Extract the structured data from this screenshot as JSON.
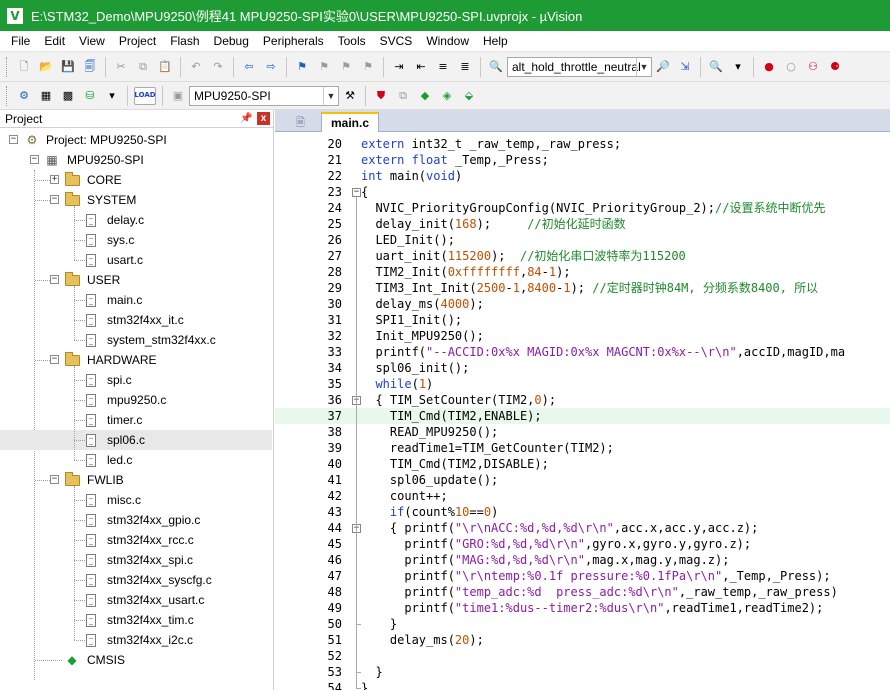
{
  "window": {
    "title": "E:\\STM32_Demo\\MPU9250\\例程41 MPU9250-SPI实验0\\USER\\MPU9250-SPI.uvprojx - µVision",
    "logo": "V"
  },
  "menu": [
    "File",
    "Edit",
    "View",
    "Project",
    "Flash",
    "Debug",
    "Peripherals",
    "Tools",
    "SVCS",
    "Window",
    "Help"
  ],
  "toolbar1": {
    "find_combo": "alt_hold_throttle_neutral"
  },
  "toolbar2": {
    "load_label": "LOAD",
    "target_combo": "MPU9250-SPI"
  },
  "project_panel": {
    "title": "Project",
    "pin": "ꟷ",
    "close": "x",
    "root": "Project: MPU9250-SPI",
    "target": "MPU9250-SPI",
    "groups": [
      {
        "name": "CORE",
        "expanded": false,
        "files": []
      },
      {
        "name": "SYSTEM",
        "expanded": true,
        "files": [
          "delay.c",
          "sys.c",
          "usart.c"
        ]
      },
      {
        "name": "USER",
        "expanded": true,
        "files": [
          "main.c",
          "stm32f4xx_it.c",
          "system_stm32f4xx.c"
        ]
      },
      {
        "name": "HARDWARE",
        "expanded": true,
        "files": [
          "spi.c",
          "mpu9250.c",
          "timer.c",
          "spl06.c",
          "led.c"
        ]
      },
      {
        "name": "FWLIB",
        "expanded": true,
        "files": [
          "misc.c",
          "stm32f4xx_gpio.c",
          "stm32f4xx_rcc.c",
          "stm32f4xx_spi.c",
          "stm32f4xx_syscfg.c",
          "stm32f4xx_usart.c",
          "stm32f4xx_tim.c",
          "stm32f4xx_i2c.c"
        ]
      }
    ],
    "cmsis": "CMSIS",
    "selected_file": "spl06.c"
  },
  "editor": {
    "tab": "main.c",
    "current_line": 37,
    "lines": [
      {
        "n": "20",
        "tokens": [
          [
            "kw",
            "extern"
          ],
          [
            "p",
            " int32_t _raw_temp,_raw_press;"
          ]
        ]
      },
      {
        "n": "21",
        "tokens": [
          [
            "kw",
            "extern"
          ],
          [
            "p",
            " "
          ],
          [
            "kw",
            "float"
          ],
          [
            "p",
            " _Temp,_Press;"
          ]
        ]
      },
      {
        "n": "22",
        "tokens": [
          [
            "kw",
            "int"
          ],
          [
            "p",
            " main("
          ],
          [
            "kw",
            "void"
          ],
          [
            "p",
            ")"
          ]
        ]
      },
      {
        "n": "23",
        "tokens": [
          [
            "p",
            "{"
          ]
        ]
      },
      {
        "n": "24",
        "tokens": [
          [
            "p",
            "  NVIC_PriorityGroupConfig(NVIC_PriorityGroup_2);"
          ],
          [
            "cmt",
            "//设置系统中断优先"
          ]
        ]
      },
      {
        "n": "25",
        "tokens": [
          [
            "p",
            "  delay_init("
          ],
          [
            "num",
            "168"
          ],
          [
            "p",
            ");     "
          ],
          [
            "cmt",
            "//初始化延时函数"
          ]
        ]
      },
      {
        "n": "26",
        "tokens": [
          [
            "p",
            "  LED_Init();"
          ]
        ]
      },
      {
        "n": "27",
        "tokens": [
          [
            "p",
            "  uart_init("
          ],
          [
            "num",
            "115200"
          ],
          [
            "p",
            ");  "
          ],
          [
            "cmt",
            "//初始化串口波特率为115200"
          ]
        ]
      },
      {
        "n": "28",
        "tokens": [
          [
            "p",
            "  TIM2_Init("
          ],
          [
            "num",
            "0xffffffff"
          ],
          [
            "p",
            ","
          ],
          [
            "num",
            "84"
          ],
          [
            "p",
            "-"
          ],
          [
            "num",
            "1"
          ],
          [
            "p",
            ");"
          ]
        ]
      },
      {
        "n": "29",
        "tokens": [
          [
            "p",
            "  TIM3_Int_Init("
          ],
          [
            "num",
            "2500"
          ],
          [
            "p",
            "-"
          ],
          [
            "num",
            "1"
          ],
          [
            "p",
            ","
          ],
          [
            "num",
            "8400"
          ],
          [
            "p",
            "-"
          ],
          [
            "num",
            "1"
          ],
          [
            "p",
            "); "
          ],
          [
            "cmt",
            "//定时器时钟84M, 分频系数8400, 所以"
          ]
        ]
      },
      {
        "n": "30",
        "tokens": [
          [
            "p",
            "  delay_ms("
          ],
          [
            "num",
            "4000"
          ],
          [
            "p",
            ");"
          ]
        ]
      },
      {
        "n": "31",
        "tokens": [
          [
            "p",
            "  SPI1_Init();"
          ]
        ]
      },
      {
        "n": "32",
        "tokens": [
          [
            "p",
            "  Init_MPU9250();"
          ]
        ]
      },
      {
        "n": "33",
        "tokens": [
          [
            "p",
            "  printf("
          ],
          [
            "str",
            "\"--ACCID:0x%x MAGID:0x%x MAGCNT:0x%x--\\r\\n\""
          ],
          [
            "p",
            ",accID,magID,ma"
          ]
        ]
      },
      {
        "n": "34",
        "tokens": [
          [
            "p",
            "  spl06_init();"
          ]
        ]
      },
      {
        "n": "35",
        "tokens": [
          [
            "p",
            "  "
          ],
          [
            "kw",
            "while"
          ],
          [
            "p",
            "("
          ],
          [
            "num",
            "1"
          ],
          [
            "p",
            ")"
          ]
        ]
      },
      {
        "n": "36",
        "tokens": [
          [
            "p",
            "  { TIM_SetCounter(TIM2,"
          ],
          [
            "num",
            "0"
          ],
          [
            "p",
            ");"
          ]
        ]
      },
      {
        "n": "37",
        "tokens": [
          [
            "p",
            "    TIM_Cmd(TIM2,ENABLE);"
          ]
        ]
      },
      {
        "n": "38",
        "tokens": [
          [
            "p",
            "    READ_MPU9250();"
          ]
        ]
      },
      {
        "n": "39",
        "tokens": [
          [
            "p",
            "    readTime1=TIM_GetCounter(TIM2);"
          ]
        ]
      },
      {
        "n": "40",
        "tokens": [
          [
            "p",
            "    TIM_Cmd(TIM2,DISABLE);"
          ]
        ]
      },
      {
        "n": "41",
        "tokens": [
          [
            "p",
            "    spl06_update();"
          ]
        ]
      },
      {
        "n": "42",
        "tokens": [
          [
            "p",
            "    count++;"
          ]
        ]
      },
      {
        "n": "43",
        "tokens": [
          [
            "p",
            "    "
          ],
          [
            "kw",
            "if"
          ],
          [
            "p",
            "(count%"
          ],
          [
            "num",
            "10"
          ],
          [
            "p",
            "=="
          ],
          [
            "num",
            "0"
          ],
          [
            "p",
            ")"
          ]
        ]
      },
      {
        "n": "44",
        "tokens": [
          [
            "p",
            "    { printf("
          ],
          [
            "str",
            "\"\\r\\nACC:%d,%d,%d\\r\\n\""
          ],
          [
            "p",
            ",acc.x,acc.y,acc.z);"
          ]
        ]
      },
      {
        "n": "45",
        "tokens": [
          [
            "p",
            "      printf("
          ],
          [
            "str",
            "\"GRO:%d,%d,%d\\r\\n\""
          ],
          [
            "p",
            ",gyro.x,gyro.y,gyro.z);"
          ]
        ]
      },
      {
        "n": "46",
        "tokens": [
          [
            "p",
            "      printf("
          ],
          [
            "str",
            "\"MAG:%d,%d,%d\\r\\n\""
          ],
          [
            "p",
            ",mag.x,mag.y,mag.z);"
          ]
        ]
      },
      {
        "n": "47",
        "tokens": [
          [
            "p",
            "      printf("
          ],
          [
            "str",
            "\"\\r\\ntemp:%0.1f pressure:%0.1fPa\\r\\n\""
          ],
          [
            "p",
            ",_Temp,_Press);"
          ]
        ]
      },
      {
        "n": "48",
        "tokens": [
          [
            "p",
            "      printf("
          ],
          [
            "str",
            "\"temp_adc:%d  press_adc:%d\\r\\n\""
          ],
          [
            "p",
            ",_raw_temp,_raw_press)"
          ]
        ]
      },
      {
        "n": "49",
        "tokens": [
          [
            "p",
            "      printf("
          ],
          [
            "str",
            "\"time1:%dus--timer2:%dus\\r\\n\""
          ],
          [
            "p",
            ",readTime1,readTime2);"
          ]
        ]
      },
      {
        "n": "50",
        "tokens": [
          [
            "p",
            "    }"
          ]
        ]
      },
      {
        "n": "51",
        "tokens": [
          [
            "p",
            "    delay_ms("
          ],
          [
            "num",
            "20"
          ],
          [
            "p",
            ");"
          ]
        ]
      },
      {
        "n": "52",
        "tokens": [
          [
            "p",
            ""
          ]
        ]
      },
      {
        "n": "53",
        "tokens": [
          [
            "p",
            "  }"
          ]
        ]
      },
      {
        "n": "54",
        "tokens": [
          [
            "p",
            "}"
          ]
        ]
      }
    ]
  },
  "colors": {
    "titlebar": "#1e9b34",
    "keyword": "#1f3fd0",
    "number": "#c24f00",
    "string": "#8a1da6",
    "comment": "#1e8a2c",
    "current_line": "#e8f8ec"
  }
}
